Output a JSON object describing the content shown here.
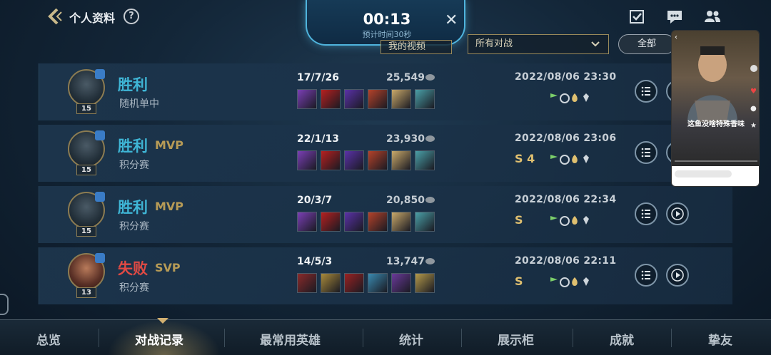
{
  "header": {
    "title": "个人资料",
    "help_icon": "help-circle-icon",
    "icons": [
      "task-icon",
      "chat-icon",
      "friends-icon"
    ]
  },
  "timer": {
    "time": "00:13",
    "subtitle": "预计时间30秒",
    "close": "✕"
  },
  "filters": {
    "video_label": "我的视频",
    "battle_type": "所有对战",
    "all_label": "全部"
  },
  "matches": [
    {
      "result": "胜利",
      "result_type": "win",
      "mvp": "",
      "mode": "随机单中",
      "level": "15",
      "kda": "17/7/26",
      "gold": "25,549",
      "date": "2022/08/06 23:30",
      "honors": "",
      "items": [
        "#7a3fb5",
        "#b62020",
        "#5a32a8",
        "#b4422a",
        "#c9a96a",
        "#4aa0a8"
      ]
    },
    {
      "result": "胜利",
      "result_type": "win",
      "mvp": "MVP",
      "mode": "积分赛",
      "level": "15",
      "kda": "22/1/13",
      "gold": "23,930",
      "date": "2022/08/06 23:06",
      "honors": "S 4",
      "items": [
        "#7a3fb5",
        "#b62020",
        "#5a32a8",
        "#b4422a",
        "#c9a96a",
        "#4aa0a8"
      ]
    },
    {
      "result": "胜利",
      "result_type": "win",
      "mvp": "MVP",
      "mode": "积分赛",
      "level": "15",
      "kda": "20/3/7",
      "gold": "20,850",
      "date": "2022/08/06 22:34",
      "honors": "S",
      "items": [
        "#7a3fb5",
        "#b62020",
        "#5a32a8",
        "#b4422a",
        "#c9a96a",
        "#4aa0a8"
      ]
    },
    {
      "result": "失败",
      "result_type": "loss",
      "mvp": "SVP",
      "mode": "积分赛",
      "level": "13",
      "kda": "14/5/3",
      "gold": "13,747",
      "date": "2022/08/06 22:11",
      "honors": "S",
      "items": [
        "#8a2a2a",
        "#a88a3a",
        "#9a2222",
        "#3a8ab0",
        "#6a3a9a",
        "#b49a4a"
      ]
    }
  ],
  "video_overlay": {
    "caption": "这鱼没啥特殊香味"
  },
  "tabs": [
    {
      "label": "总览",
      "active": false
    },
    {
      "label": "对战记录",
      "active": true
    },
    {
      "label": "最常用英雄",
      "active": false
    },
    {
      "label": "统计",
      "active": false
    },
    {
      "label": "展示柜",
      "active": false
    },
    {
      "label": "成就",
      "active": false
    },
    {
      "label": "挚友",
      "active": false
    }
  ],
  "colors": {
    "win": "#3fb6d6",
    "loss": "#e04a44",
    "gold_accent": "#b79b56",
    "honor_gold": "#e0c070",
    "honor_green": "#7ccf6a"
  }
}
